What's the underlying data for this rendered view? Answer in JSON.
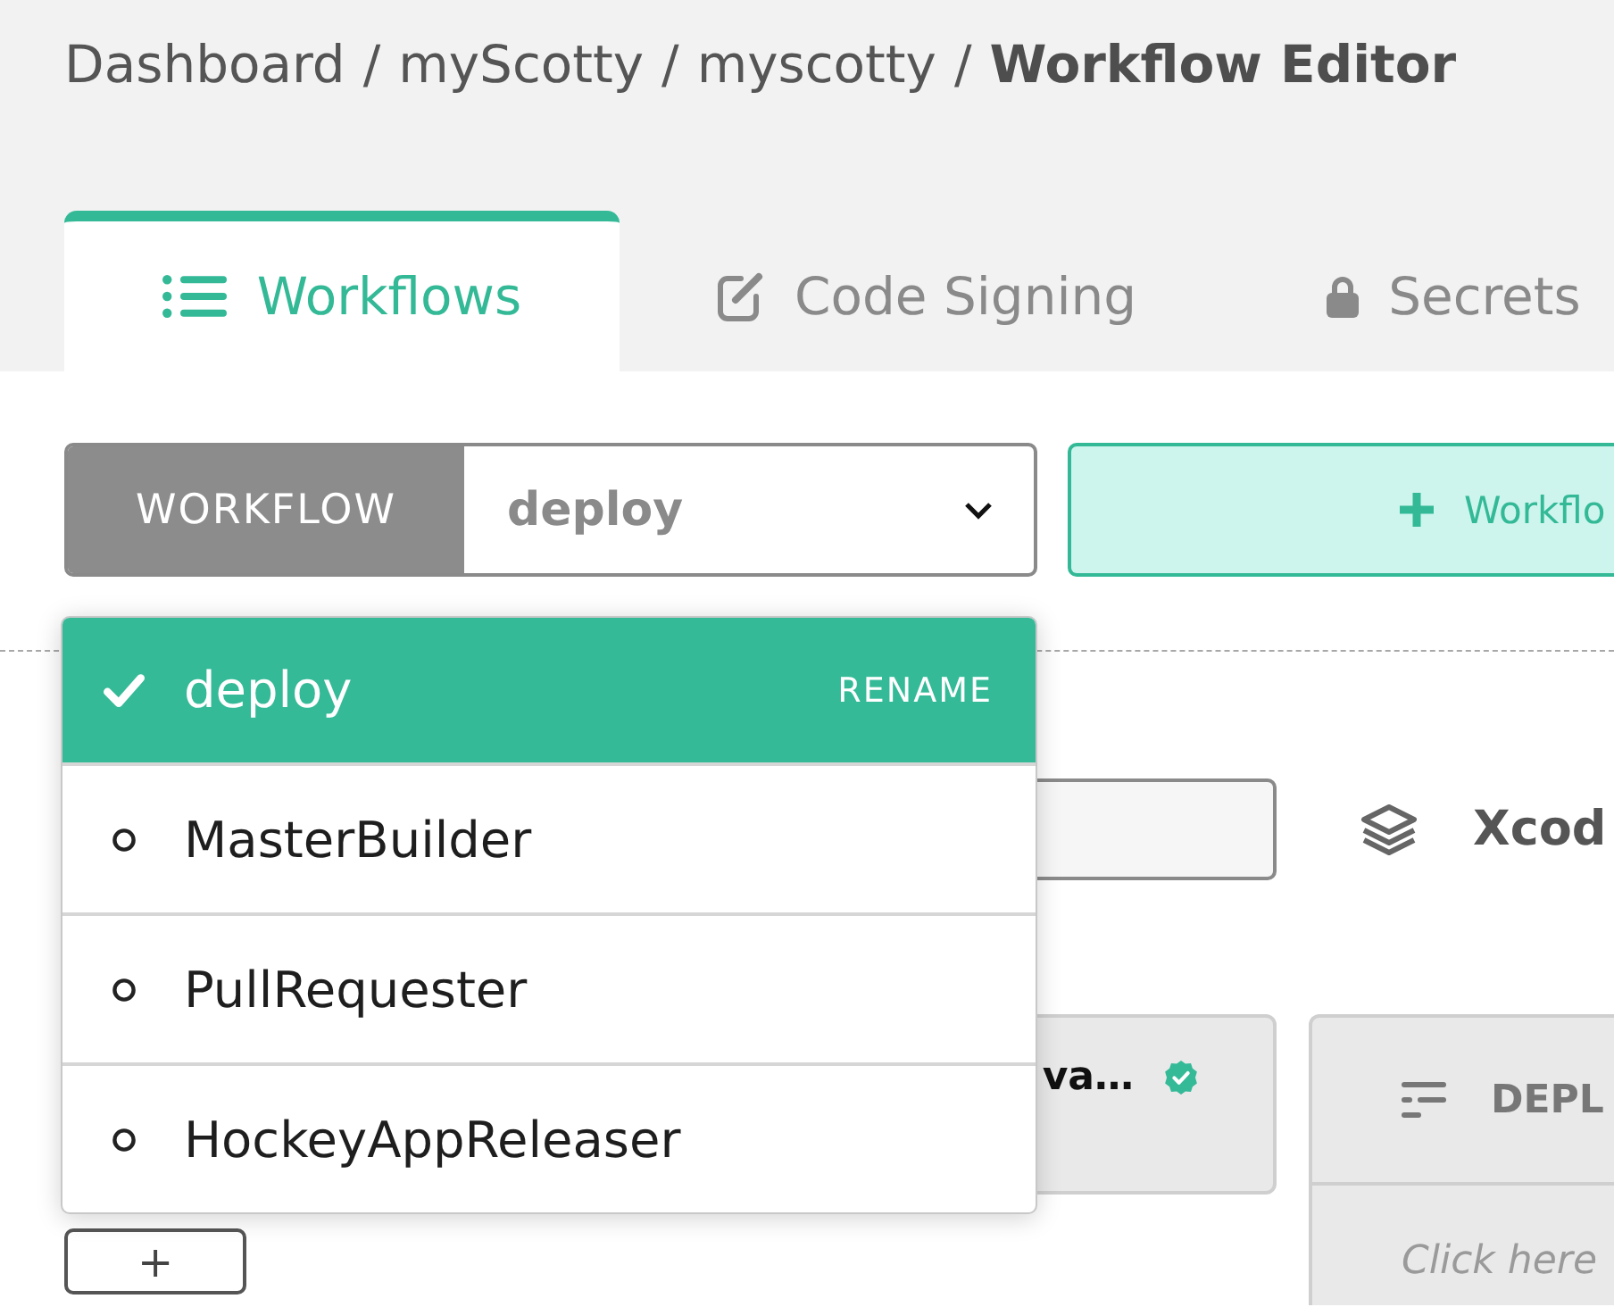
{
  "breadcrumb": [
    {
      "kind": "link",
      "text": "Dashboard"
    },
    {
      "kind": "separator",
      "text": "/"
    },
    {
      "kind": "link",
      "text": "myScotty"
    },
    {
      "kind": "separator",
      "text": "/"
    },
    {
      "kind": "link",
      "text": "myscotty"
    },
    {
      "kind": "separator",
      "text": "/"
    },
    {
      "kind": "current",
      "text": "Workflow Editor"
    }
  ],
  "tabs": [
    {
      "label": "Workflows",
      "selected": true
    },
    {
      "label": "Code Signing",
      "selected": false
    },
    {
      "label": "Secrets",
      "selected": false
    }
  ],
  "workflow_selector": {
    "label": "WORKFLOW",
    "value": "deploy",
    "expanded": true
  },
  "add_workflow_button": {
    "label": "Workflo"
  },
  "workflow_menu": {
    "items": [
      {
        "name": "deploy",
        "selected": true,
        "action": "RENAME"
      },
      {
        "name": "MasterBuilder",
        "selected": false
      },
      {
        "name": "PullRequester",
        "selected": false
      },
      {
        "name": "HockeyAppReleaser",
        "selected": false
      }
    ]
  },
  "stack": {
    "label": "Xcod"
  },
  "step_card": {
    "title": "va…",
    "verified": true
  },
  "add_step_button": {
    "label": "+"
  },
  "deploy_card": {
    "title": "DEPL",
    "hint": "Click here"
  }
}
